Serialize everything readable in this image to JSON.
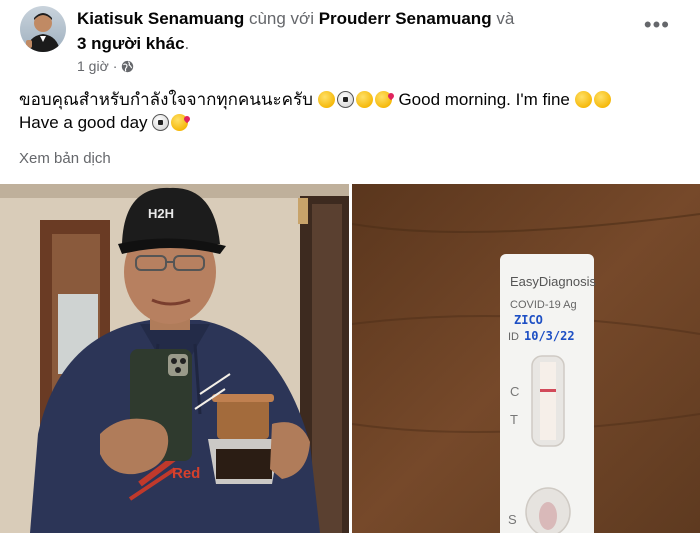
{
  "post": {
    "author": "Kiatisuk Senamuang",
    "with_word": "cùng với",
    "tagged": "Prouderr Senamuang",
    "and_word": "và",
    "others": "3 người khác",
    "period": ".",
    "time": "1 giờ",
    "dot": "·",
    "text_thai": "ขอบคุณสำหรับกำลังใจจากทุกคนนะครับ",
    "text_en1": "Good morning. I'm fine",
    "text_en2": "Have a good day",
    "translate_label": "Xem bản dịch",
    "more_label": "•••"
  },
  "test_kit": {
    "brand": "EasyDiagnosis",
    "test_name": "COVID-19 Ag",
    "handwritten_name": "ZICO",
    "id_label": "ID",
    "handwritten_date": "10/3/22",
    "c_label": "C",
    "t_label": "T",
    "s_label": "S"
  },
  "cap": {
    "logo_text": "H2H"
  },
  "hoodie": {
    "text": "Red"
  },
  "colors": {
    "link_gray": "#65676b",
    "text": "#050505",
    "pen_blue": "#1d4fc4"
  },
  "icons": {
    "privacy": "globe-icon",
    "menu": "more-horizontal-icon"
  }
}
